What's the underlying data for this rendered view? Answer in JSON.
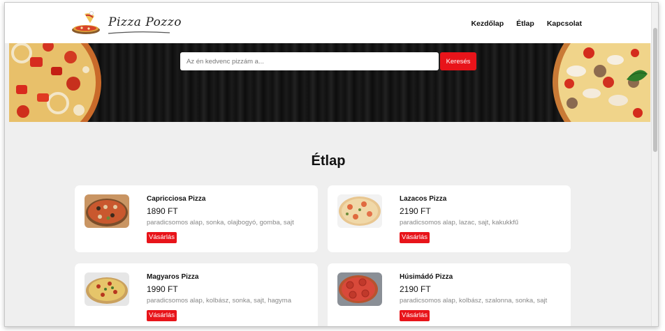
{
  "brand": {
    "name": "Pizza Pozzo",
    "logo_icon": "pizza-chef-logo"
  },
  "nav": {
    "items": [
      {
        "label": "Kezdőlap"
      },
      {
        "label": "Étlap"
      },
      {
        "label": "Kapcsolat"
      }
    ]
  },
  "search": {
    "placeholder": "Az én kedvenc pizzám a...",
    "value": "",
    "button_label": "Keresés"
  },
  "menu": {
    "title": "Étlap",
    "items": [
      {
        "name": "Capricciosa Pizza",
        "price": "1890 FT",
        "ingredients": "paradicsomos alap, sonka, olajbogyó, gomba, sajt",
        "buy_label": "Vásárlás"
      },
      {
        "name": "Lazacos Pizza",
        "price": "2190 FT",
        "ingredients": "paradicsomos alap, lazac, sajt, kakukkfű",
        "buy_label": "Vásárlás"
      },
      {
        "name": "Magyaros Pizza",
        "price": "1990 FT",
        "ingredients": "paradicsomos alap, kolbász, sonka, sajt, hagyma",
        "buy_label": "Vásárlás"
      },
      {
        "name": "Húsimádó Pizza",
        "price": "2190 FT",
        "ingredients": "paradicsomos alap, kolbász, szalonna, sonka, sajt",
        "buy_label": "Vásárlás"
      }
    ]
  },
  "colors": {
    "accent": "#e8141a",
    "background": "#efefef",
    "card": "#ffffff",
    "hero": "#141414"
  }
}
